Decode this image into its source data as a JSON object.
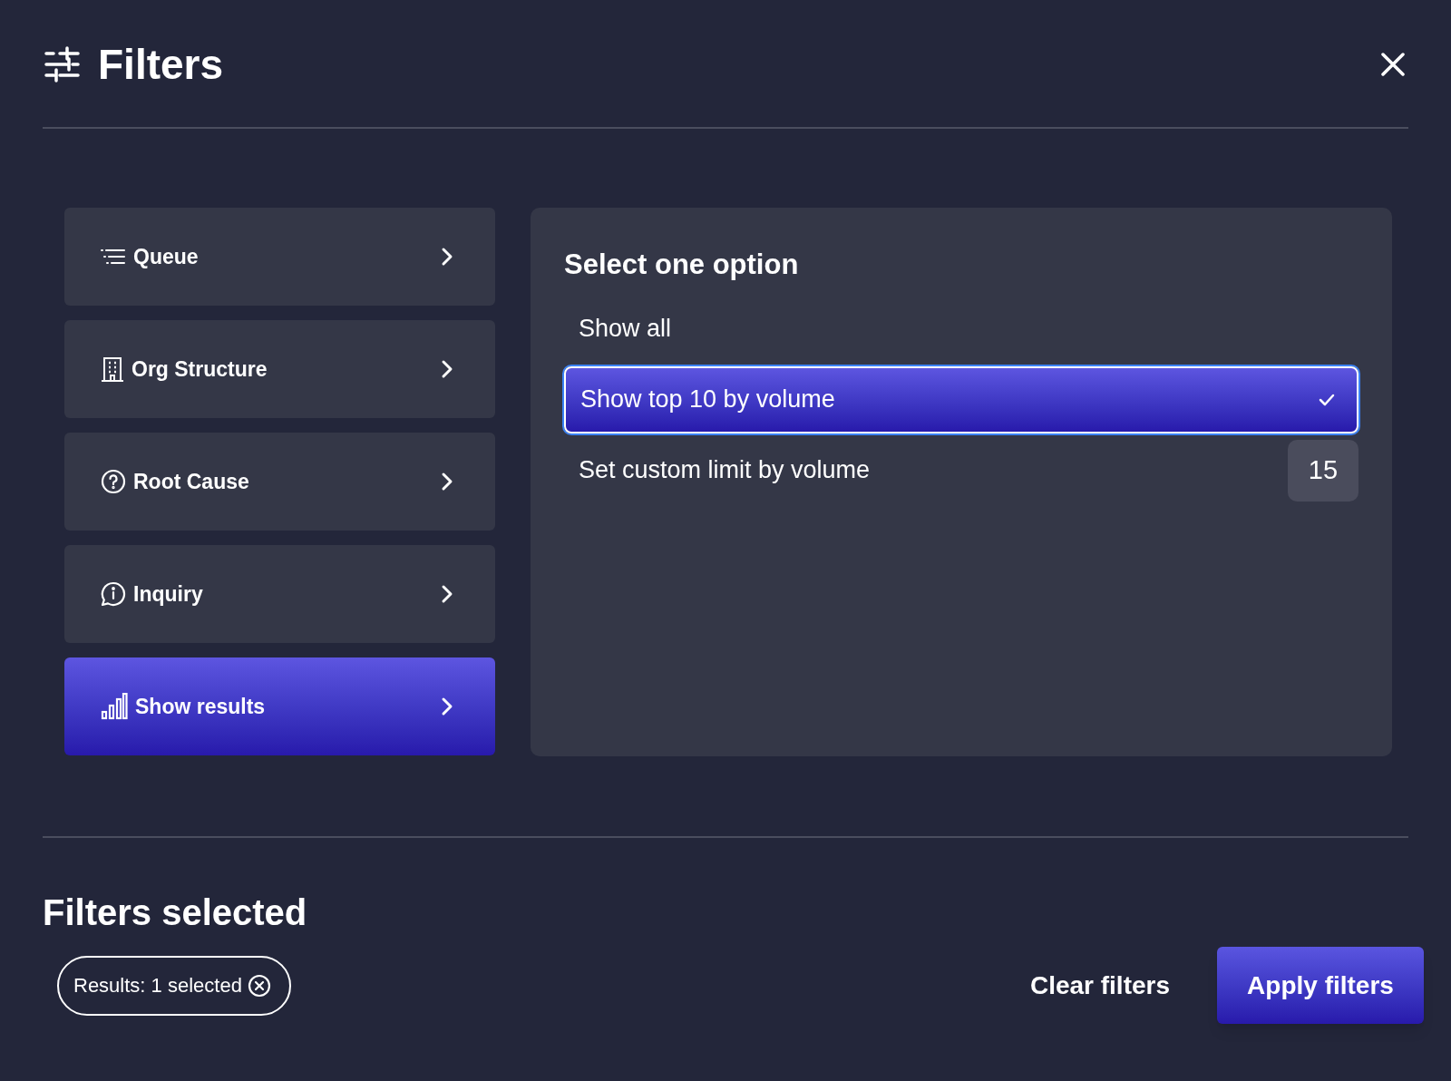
{
  "header": {
    "title": "Filters"
  },
  "categories": [
    {
      "kind": "queue",
      "label": "Queue",
      "selected": false
    },
    {
      "kind": "org",
      "label": "Org Structure",
      "selected": false
    },
    {
      "kind": "question",
      "label": "Root Cause",
      "selected": false
    },
    {
      "kind": "info",
      "label": "Inquiry",
      "selected": false
    },
    {
      "kind": "chart",
      "label": "Show results",
      "selected": true
    }
  ],
  "options_panel": {
    "heading": "Select one option",
    "options": [
      {
        "kind": "plain",
        "label": "Show all",
        "selected": false
      },
      {
        "kind": "plain",
        "label": "Show top 10 by volume",
        "selected": true
      },
      {
        "kind": "custom",
        "label": "Set custom limit by volume",
        "selected": false,
        "value": "15"
      }
    ]
  },
  "selected_filters": {
    "heading": "Filters selected",
    "chips": [
      "Results: 1 selected"
    ]
  },
  "buttons": {
    "clear": "Clear filters",
    "apply": "Apply filters"
  }
}
